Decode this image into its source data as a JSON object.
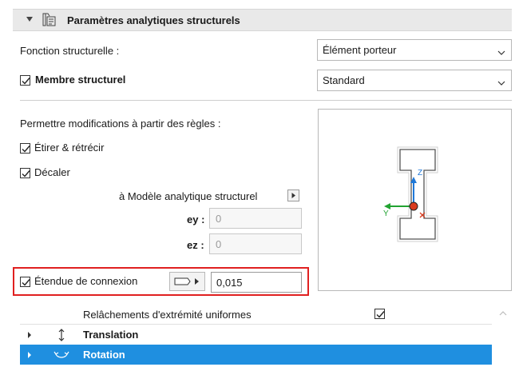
{
  "panel": {
    "title": "Paramètres analytiques structurels",
    "icon": "structural-settings-icon"
  },
  "structural_function": {
    "label": "Fonction structurelle :",
    "value": "Élément porteur"
  },
  "structural_member": {
    "label": "Membre structurel",
    "checked": true,
    "value": "Standard"
  },
  "rules": {
    "heading": "Permettre modifications à partir des règles :",
    "stretch_label": "Étirer & rétrécir",
    "offset_label": "Décaler"
  },
  "analytical_model": {
    "label": "à Modèle analytique structurel",
    "ey_label": "ey :",
    "ey_value": "0",
    "ez_label": "ez :",
    "ez_value": "0"
  },
  "connection": {
    "label": "Étendue de connexion",
    "value": "0,015"
  },
  "preview": {
    "axis_z": "Z",
    "axis_y": "Y",
    "colors": {
      "z_axis": "#1e78d8",
      "y_axis": "#22a332",
      "origin": "#d83a1e"
    }
  },
  "table": {
    "uniform_release_label": "Relâchements d'extrémité uniformes",
    "uniform_release_checked": true,
    "rows": [
      {
        "label": "Translation",
        "icon": "translation-icon"
      },
      {
        "label": "Rotation",
        "icon": "rotation-icon",
        "selected": true
      }
    ]
  },
  "colors": {
    "selection": "#1f8fe0",
    "highlight_border": "#e02020"
  }
}
